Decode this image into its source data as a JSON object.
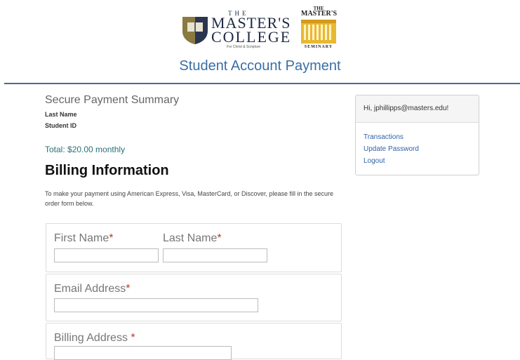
{
  "header": {
    "college_logo": {
      "the": "THE",
      "masters": "MASTER'S",
      "college": "COLLEGE",
      "tagline": "For Christ & Scripture"
    },
    "seminary_logo": {
      "the": "THE",
      "masters": "MASTER'S",
      "seminary": "SEMINARY",
      "color": "#e8b830"
    },
    "page_title": "Student Account Payment",
    "accent_color": "#3a6ea5"
  },
  "summary": {
    "title": "Secure Payment Summary",
    "last_name_label": "Last Name",
    "student_id_label": "Student ID",
    "total": "Total: $20.00 monthly"
  },
  "billing": {
    "title": "Billing Information",
    "instructions": "To make your payment using American Express, Visa, MasterCard, or Discover, please fill in the secure order form below.",
    "first_name": {
      "label": "First Name",
      "value": ""
    },
    "last_name": {
      "label": "Last Name",
      "value": ""
    },
    "email": {
      "label": "Email Address",
      "value": ""
    },
    "address": {
      "label": "Billing Address ",
      "value": ""
    },
    "required_mark": "*"
  },
  "account": {
    "greeting": "Hi, jphillipps@masters.edu!",
    "links": {
      "transactions": "Transactions",
      "update_password": "Update Password",
      "logout": "Logout"
    }
  }
}
